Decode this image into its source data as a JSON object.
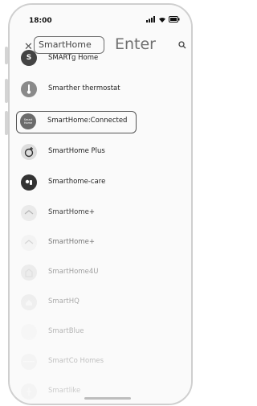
{
  "status_bar": {
    "time": "18:00",
    "icons": [
      "signal-icon",
      "wifi-icon",
      "battery-icon"
    ]
  },
  "search": {
    "query": "SmartHome",
    "enter_label": "Enter"
  },
  "list": {
    "items": [
      {
        "label": "SMARTg Home",
        "icon": "app-icon",
        "color": "#444444"
      },
      {
        "label": "Smarther thermostat",
        "icon": "thermometer-icon",
        "color": "#8a8a8a"
      },
      {
        "label": "SmartHome:Connected",
        "icon": "smarthome-icon",
        "color": "#6b6b6b",
        "icon_text": "Smart Home"
      },
      {
        "label": "SmartHome Plus",
        "icon": "home-plus-icon",
        "color": "#dddddd"
      },
      {
        "label": "Smarthome-care",
        "icon": "care-icon",
        "color": "#333333"
      },
      {
        "label": "SmartHome+",
        "icon": "home-icon",
        "color": "#e8e8e8"
      },
      {
        "label": "SmartHome+",
        "icon": "home-icon",
        "color": "#efefef"
      },
      {
        "label": "SmartHome4U",
        "icon": "home-icon",
        "color": "#d9d9d9"
      },
      {
        "label": "SmartHQ",
        "icon": "hq-icon",
        "color": "#dcdcdc"
      },
      {
        "label": "SmartBlue",
        "icon": "app-icon",
        "color": "#efefef"
      },
      {
        "label": "SmartCo Homes",
        "icon": "app-icon",
        "color": "#e5e5e5"
      },
      {
        "label": "Smartlike",
        "icon": "app-icon",
        "color": "#e0e0e0"
      }
    ]
  }
}
